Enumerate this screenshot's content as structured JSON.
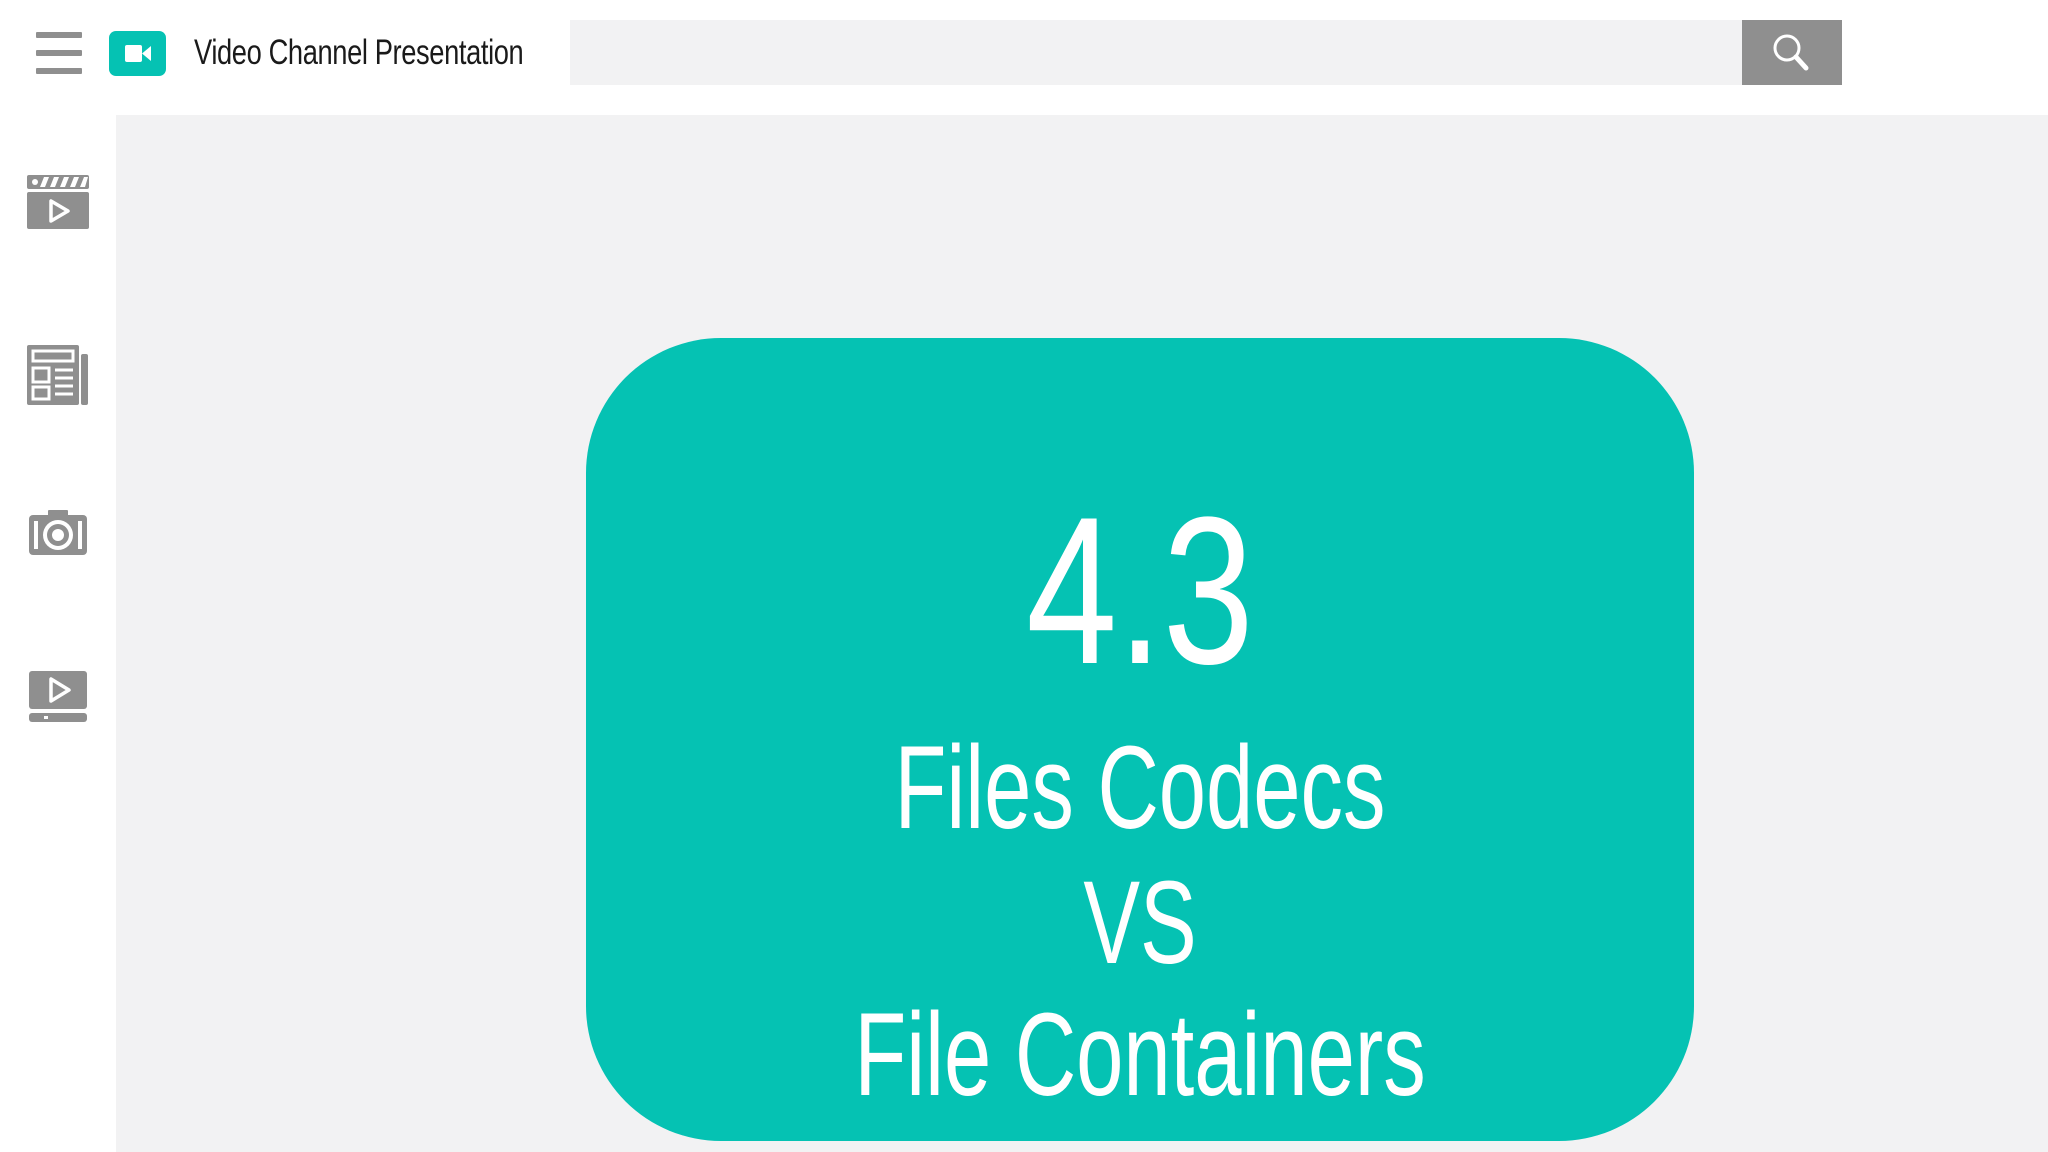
{
  "header": {
    "menu_icon": "hamburger-menu-icon",
    "logo_icon": "video-camera-icon",
    "title": "Video Channel Presentation",
    "search": {
      "value": "",
      "placeholder": "",
      "button_icon": "search-icon"
    }
  },
  "sidebar": {
    "items": [
      {
        "icon": "clapperboard-play-icon"
      },
      {
        "icon": "newspaper-icon"
      },
      {
        "icon": "camera-icon"
      },
      {
        "icon": "video-player-icon"
      }
    ]
  },
  "main": {
    "card": {
      "number": "4.3",
      "line1": "Files Codecs",
      "line2": "VS",
      "line3": "File Containers"
    }
  },
  "colors": {
    "accent": "#05c2b3",
    "icon_gray": "#8f8f8f",
    "content_background": "#f2f2f3",
    "title_text": "#1a1a1a"
  }
}
